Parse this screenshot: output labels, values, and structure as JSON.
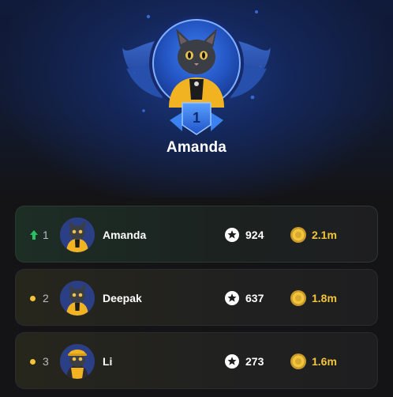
{
  "winner": {
    "name": "Amanda",
    "rank_badge": "1"
  },
  "leaderboard": [
    {
      "rank": "1",
      "trend": "up-arrow-icon",
      "name": "Amanda",
      "score": "924",
      "coins": "2.1m"
    },
    {
      "rank": "2",
      "trend": "dot",
      "name": "Deepak",
      "score": "637",
      "coins": "1.8m"
    },
    {
      "rank": "3",
      "trend": "dot",
      "name": "Li",
      "score": "273",
      "coins": "1.6m"
    }
  ],
  "icons": {
    "score": "star-icon",
    "coins": "coin-icon"
  },
  "colors": {
    "accent_gold": "#f2c53d",
    "trend_up": "#27c265",
    "hero_blue": "#1f4fb8"
  }
}
